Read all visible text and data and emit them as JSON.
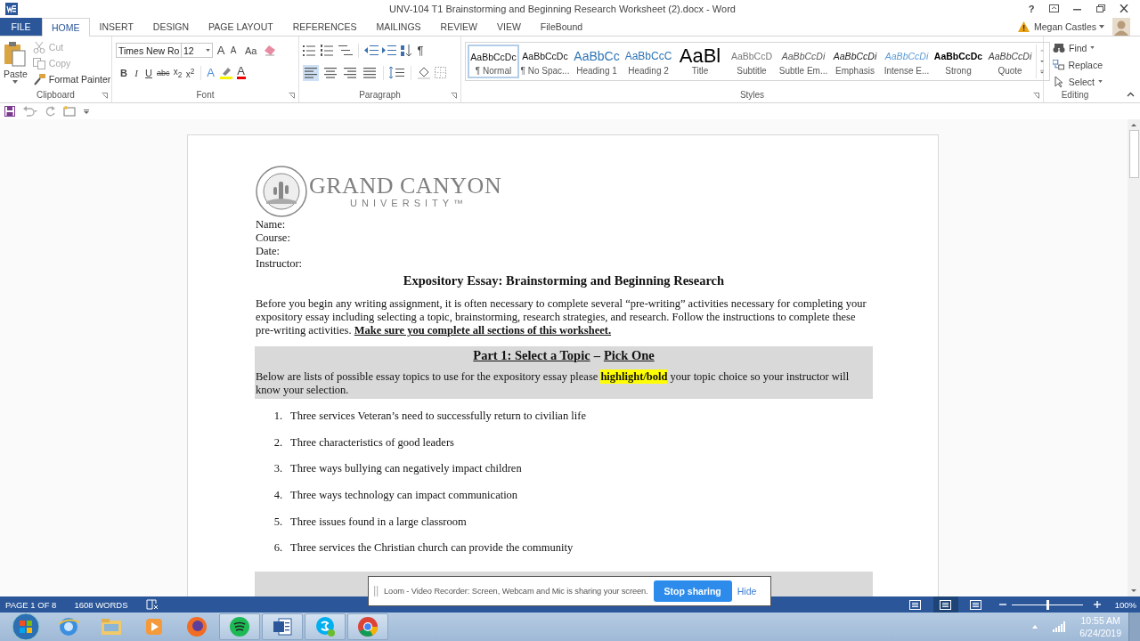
{
  "window": {
    "title": "UNV-104 T1 Brainstorming and Beginning Research Worksheet (2).docx - Word",
    "help": "?"
  },
  "tabs": [
    {
      "label": "FILE",
      "kind": "file",
      "selected": false
    },
    {
      "label": "HOME",
      "kind": "tab",
      "selected": true
    },
    {
      "label": "INSERT",
      "kind": "tab",
      "selected": false
    },
    {
      "label": "DESIGN",
      "kind": "tab",
      "selected": false
    },
    {
      "label": "PAGE LAYOUT",
      "kind": "tab",
      "selected": false
    },
    {
      "label": "REFERENCES",
      "kind": "tab",
      "selected": false
    },
    {
      "label": "MAILINGS",
      "kind": "tab",
      "selected": false
    },
    {
      "label": "REVIEW",
      "kind": "tab",
      "selected": false
    },
    {
      "label": "VIEW",
      "kind": "tab",
      "selected": false
    },
    {
      "label": "FileBound",
      "kind": "tab",
      "selected": false
    }
  ],
  "account": {
    "name": "Megan Castles"
  },
  "clipboard": {
    "label": "Clipboard",
    "paste": "Paste",
    "items": [
      {
        "label": "Cut",
        "kind": "cut",
        "disabled": true
      },
      {
        "label": "Copy",
        "kind": "copy",
        "disabled": true
      },
      {
        "label": "Format Painter",
        "kind": "painter",
        "disabled": false
      }
    ]
  },
  "font": {
    "label": "Font",
    "name": "Times New Ro",
    "size": "12",
    "grow": "A",
    "shrink": "A",
    "case": "Aa",
    "effects": "A",
    "color_button": "A",
    "styles": [
      {
        "text": "B",
        "kind": "bold"
      },
      {
        "text": "I",
        "kind": "italic"
      },
      {
        "text": "U",
        "kind": "underline"
      },
      {
        "text": "abc",
        "kind": "strike"
      },
      {
        "text": "x$_{2}$",
        "kind": "sub"
      },
      {
        "text": "x$^{2}$",
        "kind": "sup"
      }
    ]
  },
  "paragraph": {
    "label": "Paragraph",
    "pilcrow": "¶",
    "alignments": [
      {
        "selected": true
      },
      {
        "selected": false
      },
      {
        "selected": false
      },
      {
        "selected": false
      }
    ]
  },
  "styles": {
    "label": "Styles",
    "items": [
      {
        "preview": "AaBbCcDc",
        "label": "¶ Normal",
        "kind": "normal",
        "selected": true
      },
      {
        "preview": "AaBbCcDc",
        "label": "¶ No Spac...",
        "kind": "normal",
        "selected": false
      },
      {
        "preview": "AaBbCc",
        "label": "Heading 1",
        "kind": "heading1",
        "selected": false
      },
      {
        "preview": "AaBbCcC",
        "label": "Heading 2",
        "kind": "heading2",
        "selected": false
      },
      {
        "preview": "AaBl",
        "label": "Title",
        "kind": "title",
        "selected": false
      },
      {
        "preview": "AaBbCcD",
        "label": "Subtitle",
        "kind": "subtitle",
        "selected": false
      },
      {
        "preview": "AaBbCcDi",
        "label": "Subtle Em...",
        "kind": "subtle",
        "selected": false
      },
      {
        "preview": "AaBbCcDi",
        "label": "Emphasis",
        "kind": "emphasis",
        "selected": false
      },
      {
        "preview": "AaBbCcDi",
        "label": "Intense E...",
        "kind": "intense",
        "selected": false
      },
      {
        "preview": "AaBbCcDc",
        "label": "Strong",
        "kind": "strong",
        "selected": false
      },
      {
        "preview": "AaBbCcDi",
        "label": "Quote",
        "kind": "quote",
        "selected": false
      }
    ]
  },
  "editing": {
    "label": "Editing",
    "items": [
      {
        "label": "Find",
        "kind": "find"
      },
      {
        "label": "Replace",
        "kind": "replace"
      },
      {
        "label": "Select",
        "kind": "select"
      }
    ]
  },
  "document": {
    "logo": {
      "name": "GRAND CANYON",
      "sub": "UNIVERSITY™"
    },
    "fields": [
      "Name:",
      "Course:",
      "Date:",
      "Instructor:"
    ],
    "heading": "Expository Essay: Brainstorming and Beginning Research",
    "intro": "Before you begin any writing assignment, it is often necessary to complete several “pre-writing” activities necessary for completing your expository essay including selecting a topic, brainstorming, research strategies, and research. Follow the instructions to complete these pre-writing activities.",
    "intro_emphasis": "Make sure you complete all sections of this worksheet.",
    "part": {
      "title": "Part 1: Select a Topic",
      "separator": "–",
      "subtitle": "Pick One"
    },
    "instruction": {
      "before": "Below are lists of possible essay topics to use for the expository essay please",
      "highlight": "highlight/bold",
      "after": "your topic choice so your instructor will know your selection."
    },
    "topics": [
      {
        "number": "1.",
        "text": "Three services Veteran’s need to successfully return to civilian life"
      },
      {
        "number": "2.",
        "text": "Three characteristics of good leaders"
      },
      {
        "number": "3.",
        "text": "Three ways bullying can negatively impact children"
      },
      {
        "number": "4.",
        "text": "Three ways technology can impact communication"
      },
      {
        "number": "5.",
        "text": "Three issues found in a large classroom"
      },
      {
        "number": "6.",
        "text": "Three services the Christian church can provide the community"
      }
    ]
  },
  "loom": {
    "message": "Loom - Video Recorder: Screen, Webcam and Mic is sharing your screen.",
    "stop": "Stop sharing",
    "hide": "Hide"
  },
  "status_bar": {
    "page": "PAGE 1 OF 8",
    "words": "1608 WORDS",
    "views": [
      {
        "selected": false
      },
      {
        "selected": true
      },
      {
        "selected": false
      }
    ],
    "zoom": {
      "level": 0.5,
      "reading": "100%"
    }
  },
  "taskbar": {
    "apps": [
      {
        "kind": "ie",
        "running": false
      },
      {
        "kind": "folder",
        "running": false
      },
      {
        "kind": "media",
        "running": false
      },
      {
        "kind": "firefox",
        "running": false
      },
      {
        "kind": "spotify",
        "running": true
      },
      {
        "kind": "word",
        "running": true
      },
      {
        "kind": "skype",
        "running": true
      },
      {
        "kind": "chrome",
        "running": true
      }
    ],
    "time": "10:55 AM",
    "date": "6/24/2019"
  }
}
